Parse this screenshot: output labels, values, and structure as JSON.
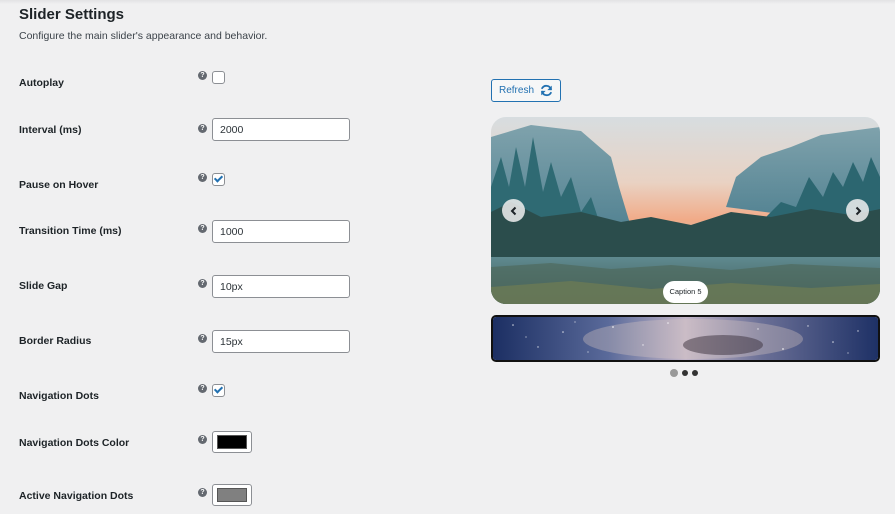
{
  "header": {
    "title": "Slider Settings",
    "subtitle": "Configure the main slider's appearance and behavior."
  },
  "settings": {
    "autoplay": {
      "label": "Autoplay",
      "checked": false
    },
    "interval": {
      "label": "Interval (ms)",
      "value": "2000"
    },
    "pause_on_hover": {
      "label": "Pause on Hover",
      "checked": true
    },
    "transition_time": {
      "label": "Transition Time (ms)",
      "value": "1000"
    },
    "slide_gap": {
      "label": "Slide Gap",
      "value": "10px"
    },
    "border_radius": {
      "label": "Border Radius",
      "value": "15px"
    },
    "navigation_dots": {
      "label": "Navigation Dots",
      "checked": true
    },
    "navigation_dots_color": {
      "label": "Navigation Dots Color",
      "color": "#000000"
    },
    "active_navigation_dots": {
      "label": "Active Navigation Dots",
      "color": "#808080"
    }
  },
  "help_icon_glyph": "?",
  "preview": {
    "refresh_label": "Refresh",
    "refresh_icon": "refresh-icon",
    "caption": "Caption 5",
    "prev_icon": "chevron-left-icon",
    "next_icon": "chevron-right-icon",
    "dots_count": 3,
    "active_dot_index": 0
  },
  "colors": {
    "accent": "#2271b1",
    "background": "#f0f0f1"
  }
}
